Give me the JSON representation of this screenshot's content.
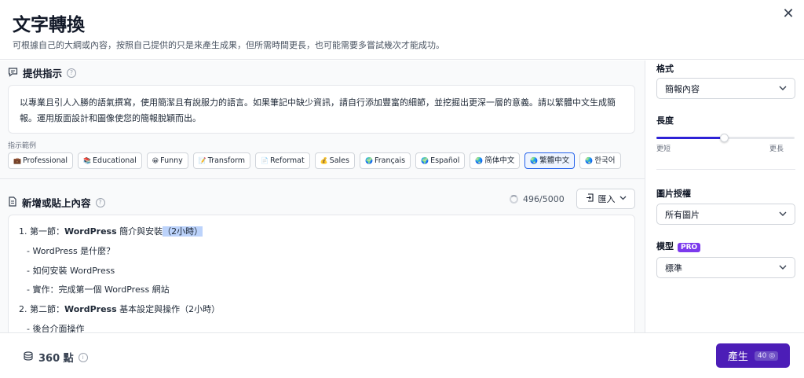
{
  "header": {
    "title": "文字轉換",
    "subtitle": "可根據自己的大綱或內容，按照自己提供的只是來產生成果，但所需時間更長，也可能需要多嘗試幾次才能成功。",
    "close_icon": "✕"
  },
  "instructions": {
    "heading": "提供指示",
    "text": "以專業且引人入勝的語氣撰寫，使用簡潔且有說服力的語言。如果筆記中缺少資訊，請自行添加豐富的細節，並挖掘出更深一層的意義。請以繁體中文生成簡報。運用版面設計和圖像使您的簡報脫穎而出。",
    "examples_label": "指示範例",
    "chips": [
      {
        "icon": "💼",
        "label": "Professional"
      },
      {
        "icon": "📚",
        "label": "Educational"
      },
      {
        "icon": "😀",
        "label": "Funny"
      },
      {
        "icon": "📝",
        "label": "Transform"
      },
      {
        "icon": "📄",
        "label": "Reformat"
      },
      {
        "icon": "💰",
        "label": "Sales"
      },
      {
        "icon": "🌍",
        "label": "Français"
      },
      {
        "icon": "🌍",
        "label": "Español"
      },
      {
        "icon": "🌏",
        "label": "简体中文"
      },
      {
        "icon": "🌏",
        "label": "繁體中文"
      },
      {
        "icon": "🌏",
        "label": "한국어"
      }
    ],
    "active_chip": "繁體中文"
  },
  "content": {
    "heading": "新增或貼上內容",
    "counter": "496/5000",
    "import_label": "匯入",
    "line1_prefix": "1. 第一節：",
    "line1_bold": "WordPress",
    "line1_mid": " 簡介與安裝",
    "line1_hl": "（2小時）",
    "line2": "- WordPress 是什麼？",
    "line3": "- 如何安裝 WordPress",
    "line4": "- 實作：完成第一個 WordPress 網站",
    "line5_prefix": "2. 第二節：",
    "line5_bold": "WordPress",
    "line5_rest": " 基本設定與操作（2小時）",
    "line6": "- 後台介面操作"
  },
  "sidebar": {
    "format_label": "格式",
    "format_value": "簡報內容",
    "length_label": "長度",
    "length_min": "更短",
    "length_max": "更長",
    "length_level": 0.49,
    "image_label": "圖片授權",
    "image_value": "所有圖片",
    "model_label": "模型",
    "model_badge": "PRO",
    "model_value": "標準"
  },
  "footer": {
    "points": "360 點",
    "generate_label": "產生",
    "generate_cost": "40 ◎"
  },
  "colors": {
    "accent": "#2e22d6",
    "generate_bg": "#4c1db7",
    "pro_badge": "#7c3aed",
    "highlight": "#bcd3fb"
  }
}
